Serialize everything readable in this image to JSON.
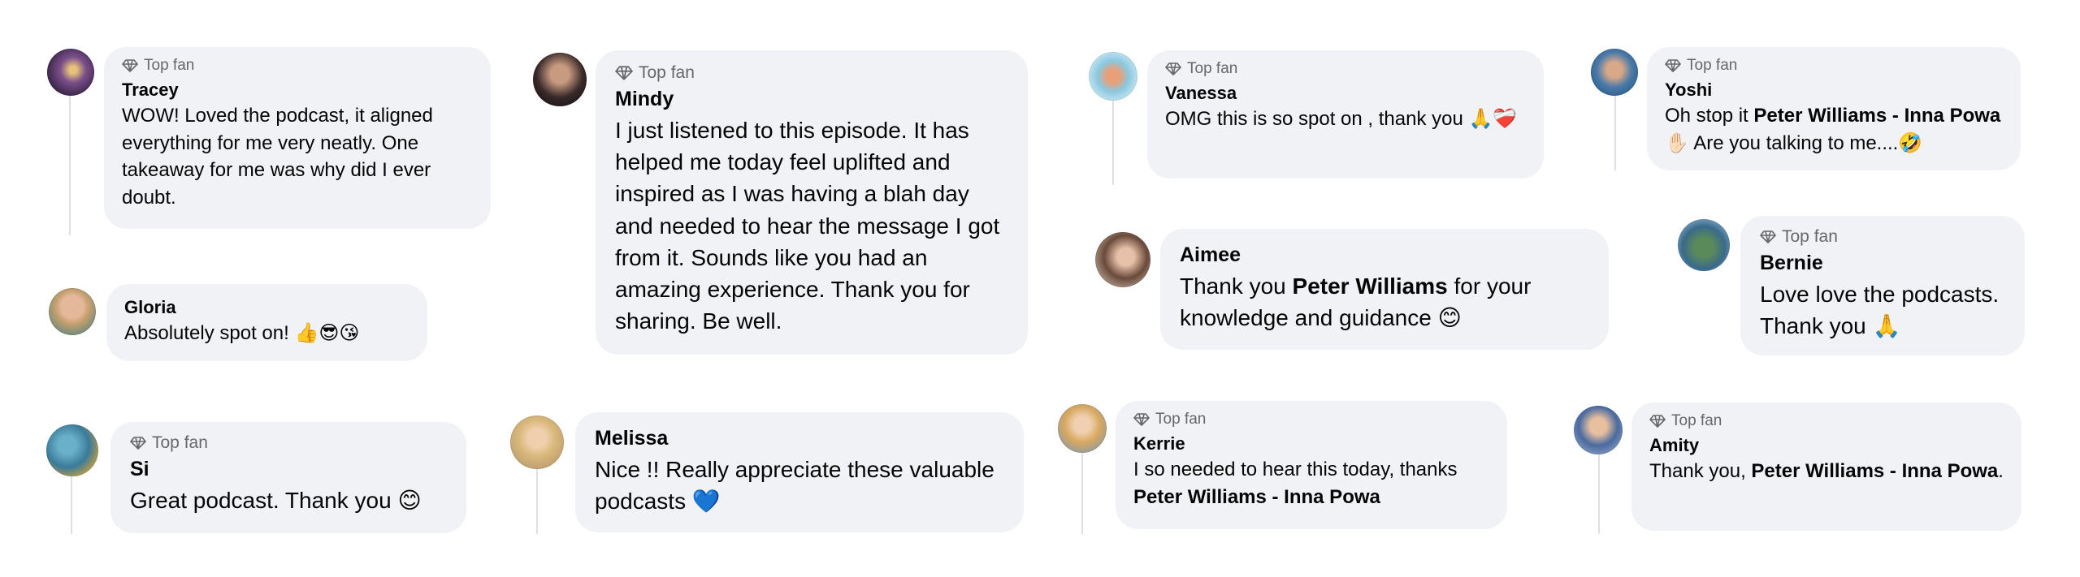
{
  "badge_label": "Top fan",
  "comments": [
    {
      "name": "Tracey",
      "top_fan": true,
      "text": "WOW! Loved the podcast, it aligned everything for me very neatly. One takeaway for me was why did I ever doubt."
    },
    {
      "name": "Gloria",
      "top_fan": false,
      "text": "Absolutely spot on! 👍😎😘"
    },
    {
      "name": "Si",
      "top_fan": true,
      "text": "Great podcast. Thank you 😊"
    },
    {
      "name": "Mindy",
      "top_fan": true,
      "text": "I just listened to this episode. It has helped me today feel uplifted and inspired as I was having a blah day and needed to hear the message I got from it. Sounds like you had an amazing experience. Thank you for sharing. Be well."
    },
    {
      "name": "Melissa",
      "top_fan": false,
      "text": "Nice !! Really appreciate these valuable podcasts 💙"
    },
    {
      "name": "Vanessa",
      "top_fan": true,
      "text": "OMG this is so spot on , thank you 🙏❤️‍🩹"
    },
    {
      "name": "Aimee",
      "top_fan": false,
      "text_before": "Thank you ",
      "mention": "Peter Williams",
      "text_after": " for your knowledge and guidance 😊"
    },
    {
      "name": "Kerrie",
      "top_fan": true,
      "text_before": "I so needed to hear this today, thanks ",
      "mention": "Peter Williams - Inna Powa",
      "text_after": ""
    },
    {
      "name": "Yoshi",
      "top_fan": true,
      "text_before": "Oh stop it ",
      "mention": "Peter Williams - Inna Powa",
      "text_after": "✋🏻 Are you talking to me....🤣"
    },
    {
      "name": "Bernie",
      "top_fan": true,
      "text": "Love love the podcasts. Thank you 🙏"
    },
    {
      "name": "Amity",
      "top_fan": true,
      "text_before": "Thank you, ",
      "mention": "Peter Williams - Inna Powa",
      "text_after": "."
    }
  ],
  "colors": {
    "bubble": "#f0f2f5",
    "badge_text": "#65676b",
    "thread_line": "#dcdfe4",
    "text": "#050505"
  }
}
